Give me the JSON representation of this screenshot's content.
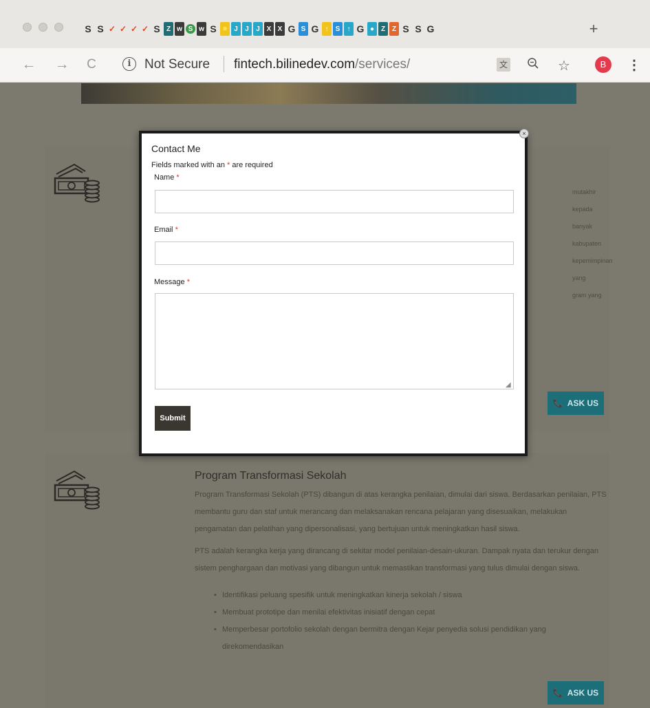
{
  "browser": {
    "tab_glyphs": [
      "S",
      "S",
      "✓",
      "✓",
      "✓",
      "✓",
      "S",
      "Z",
      "w",
      "S",
      "w",
      "S",
      "≡",
      "J",
      "J",
      "J",
      "X",
      "X",
      "G",
      "S",
      "G",
      "↑",
      "S",
      "↑",
      "G",
      "●",
      "Z",
      "Z",
      "S",
      "S",
      "G"
    ],
    "new_tab_label": "+",
    "back_icon": "←",
    "forward_icon": "→",
    "reload_icon": "C",
    "security_label": "Not Secure",
    "url_domain": "fintech.bilinedev.com",
    "url_path": "/services/",
    "avatar_initial": "B"
  },
  "modal": {
    "title": "Contact Me",
    "required_note_prefix": "Fields marked with an ",
    "required_star": "*",
    "required_note_suffix": " are required",
    "fields": {
      "name_label": "Name",
      "email_label": "Email",
      "message_label": "Message"
    },
    "submit_label": "Submit",
    "close_label": "×"
  },
  "page": {
    "card1": {
      "text_lines": [
        "mutakhir kepada",
        "banyak kabupaten",
        "",
        "kepemimpinan yang",
        "gram yang"
      ],
      "ask_label": "ASK US"
    },
    "card2": {
      "title": "Program Transformasi Sekolah",
      "paragraph1": "Program Transformasi Sekolah (PTS) dibangun di atas kerangka penilaian, dimulai dari siswa. Berdasarkan penilaian, PTS membantu guru dan staf untuk merancang dan melaksanakan rencana pelajaran yang disesuaikan, melakukan pengamatan dan pelatihan yang dipersonalisasi, yang bertujuan untuk meningkatkan hasil siswa.",
      "paragraph2": "PTS adalah kerangka kerja yang dirancang di sekitar model penilaian-desain-ukuran. Dampak nyata dan terukur dengan sistem penghargaan dan motivasi yang dibangun untuk memastikan transformasi yang tulus dimulai dengan siswa.",
      "bullets": [
        "Identifikasi peluang spesifik untuk meningkatkan kinerja sekolah / siswa",
        "Membuat prototipe dan menilai efektivitas inisiatif dengan cepat",
        "Memperbesar portofolio sekolah dengan bermitra dengan Kejar penyedia solusi pendidikan yang direkomendasikan"
      ],
      "ask_label": "ASK US"
    }
  },
  "colors": {
    "modal_border": "#1b1b1b",
    "submit_bg": "#3a3630",
    "ask_button": "#1c6e79",
    "required": "#dd3333"
  }
}
